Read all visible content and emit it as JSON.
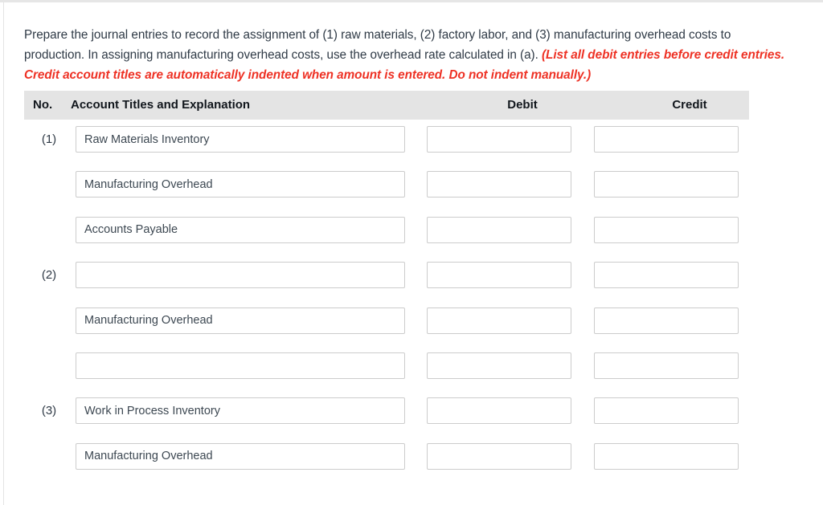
{
  "prompt": {
    "body": "Prepare the journal entries to record the assignment of (1) raw materials, (2) factory labor, and (3) manufacturing overhead costs to production. In assigning manufacturing overhead costs, use the overhead rate calculated in (a). ",
    "hint": "(List all debit entries before credit entries. Credit account titles are automatically indented when amount is entered. Do not indent manually.)"
  },
  "table": {
    "headers": {
      "no": "No.",
      "account": "Account Titles and Explanation",
      "debit": "Debit",
      "credit": "Credit"
    },
    "accent_color": "#ee3124",
    "header_bg": "#e4e4e4",
    "rows": [
      {
        "no": "(1)",
        "account": "Raw Materials Inventory",
        "debit": "",
        "credit": ""
      },
      {
        "no": "",
        "account": "Manufacturing Overhead",
        "debit": "",
        "credit": ""
      },
      {
        "no": "",
        "account": "Accounts Payable",
        "debit": "",
        "credit": ""
      },
      {
        "no": "(2)",
        "account": "",
        "debit": "",
        "credit": ""
      },
      {
        "no": "",
        "account": "Manufacturing Overhead",
        "debit": "",
        "credit": ""
      },
      {
        "no": "",
        "account": "",
        "debit": "",
        "credit": ""
      },
      {
        "no": "(3)",
        "account": "Work in Process Inventory",
        "debit": "",
        "credit": ""
      },
      {
        "no": "",
        "account": "Manufacturing Overhead",
        "debit": "",
        "credit": ""
      }
    ]
  }
}
